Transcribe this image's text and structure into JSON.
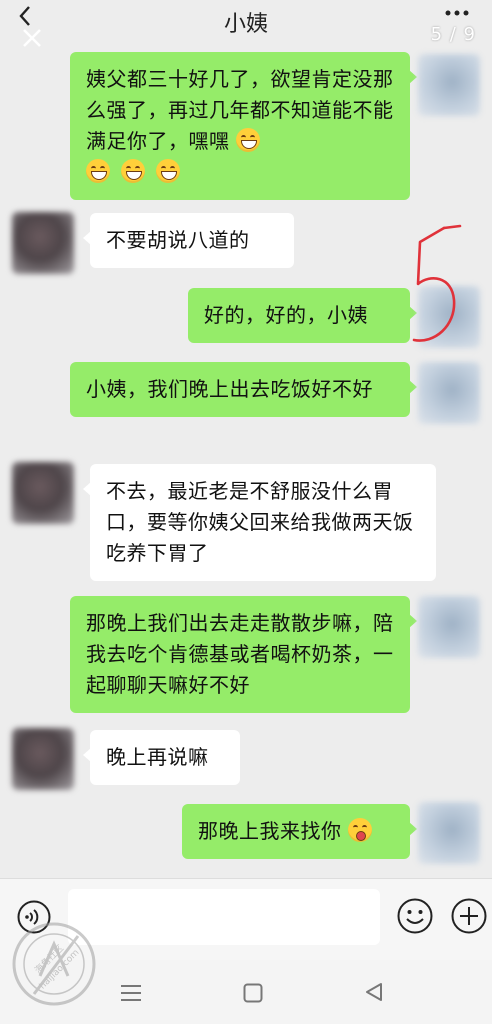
{
  "header": {
    "title": "小姨",
    "page_counter": "5 / 9"
  },
  "messages": [
    {
      "side": "right",
      "text": "姨父都三十好几了，欲望肯定没那么强了，再过几年都不知道能不能满足你了，嘿嘿",
      "emojis": [
        "grin",
        "grin",
        "grin",
        "grin"
      ]
    },
    {
      "side": "left",
      "text": "不要胡说八道的"
    },
    {
      "side": "right",
      "text": "好的，好的，小姨"
    },
    {
      "side": "right",
      "text": "小姨，我们晚上出去吃饭好不好"
    },
    {
      "side": "left",
      "text": "不去，最近老是不舒服没什么胃口，要等你姨父回来给我做两天饭吃养下胃了"
    },
    {
      "side": "right",
      "text": "那晚上我们出去走走散散步嘛，陪我去吃个肯德基或者喝杯奶茶，一起聊聊天嘛好不好"
    },
    {
      "side": "left",
      "text": "晚上再说嘛"
    },
    {
      "side": "right",
      "text": "那晚上我来找你",
      "emojis": [
        "wink"
      ]
    }
  ],
  "annotation": {
    "mark": "5"
  },
  "input_bar": {
    "value": "",
    "placeholder": ""
  },
  "watermark": {
    "line1": "海角社区",
    "line2": "haijiao.com"
  },
  "colors": {
    "background": "#ededed",
    "sent_bubble": "#95ec69",
    "received_bubble": "#ffffff",
    "annotation_ink": "#e0323a"
  },
  "icons": {
    "back": "chevron-left-icon",
    "close": "close-icon",
    "more": "more-dots-icon",
    "voice": "voice-icon",
    "emoji": "smiley-icon",
    "add": "plus-icon",
    "nav_menu": "menu-icon",
    "nav_home": "home-square-icon",
    "nav_back": "triangle-back-icon"
  }
}
